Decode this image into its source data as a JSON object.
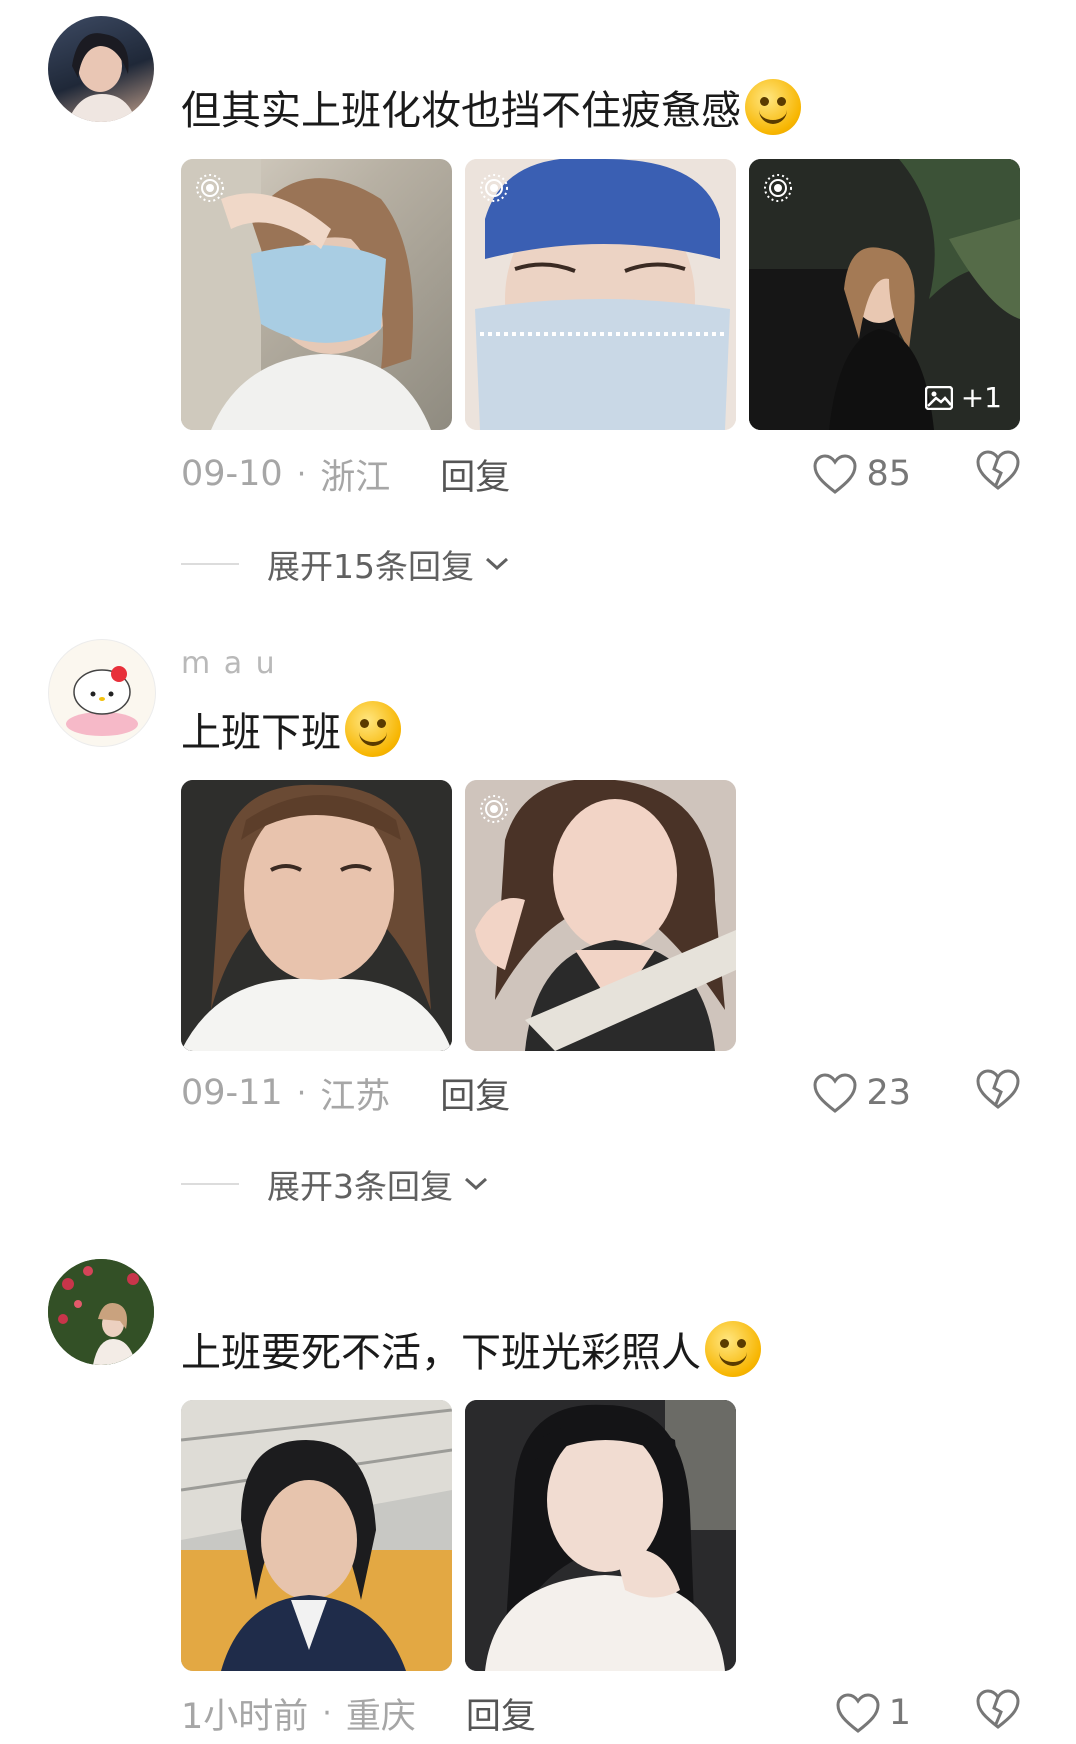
{
  "comments": [
    {
      "username": "",
      "text": "但其实上班化妆也挡不住疲惫感",
      "emoji": "grin-emoji",
      "photo_count_badge": "+1",
      "date": "09-10",
      "location": "浙江",
      "reply_label": "回复",
      "likes": "85",
      "expand_label": "展开15条回复"
    },
    {
      "username": "m a u",
      "text": "上班下班",
      "emoji": "goofy-emoji",
      "date": "09-11",
      "location": "江苏",
      "reply_label": "回复",
      "likes": "23",
      "expand_label": "展开3条回复"
    },
    {
      "username": "",
      "text": "上班要死不活，下班光彩照人",
      "emoji": "shy-emoji",
      "date": "1小时前",
      "location": "重庆",
      "reply_label": "回复",
      "likes": "1"
    }
  ],
  "separator": "·",
  "colors": {
    "meta_text": "#a6a6a6",
    "reply_text": "#555555",
    "accent_emoji": "#f7b500"
  }
}
